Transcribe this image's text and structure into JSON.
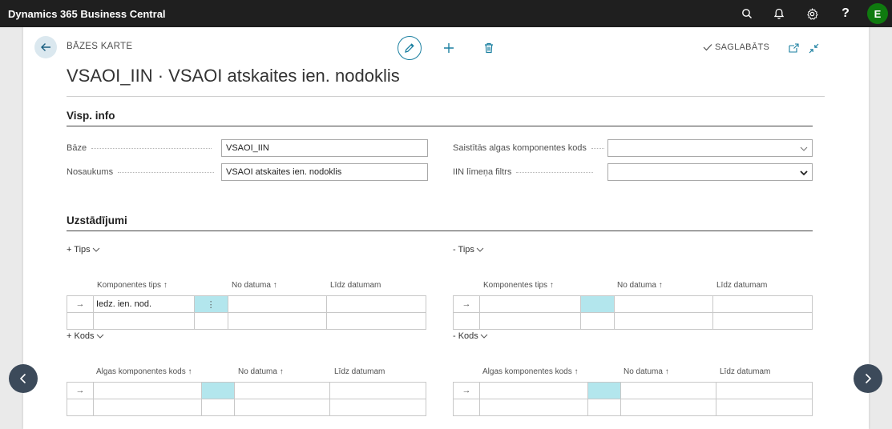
{
  "app": {
    "title": "Dynamics 365 Business Central",
    "avatar_initial": "E"
  },
  "header": {
    "breadcrumb": "BĀZES KARTE",
    "title": "VSAOI_IIN · VSAOI atskaites ien. nodoklis",
    "saved_label": "SAGLABĀTS"
  },
  "general": {
    "section_title": "Visp. info",
    "base_label": "Bāze",
    "base_value": "VSAOI_IIN",
    "name_label": "Nosaukums",
    "name_value": "VSAOI atskaites ien. nodoklis",
    "linked_label": "Saistītās algas komponentes kods",
    "linked_value": "",
    "filter_label": "IIN līmeņa filtrs",
    "filter_value": ""
  },
  "settings": {
    "section_title": "Uzstādījumi",
    "plus_tips": {
      "toggle": "+ Tips",
      "columns": [
        "Komponentes tips",
        "No datuma",
        "Līdz datumam"
      ],
      "rows": [
        [
          "Iedz. ien. nod.",
          "",
          ""
        ],
        [
          "",
          "",
          ""
        ]
      ]
    },
    "minus_tips": {
      "toggle": "- Tips",
      "columns": [
        "Komponentes tips",
        "No datuma",
        "Līdz datumam"
      ],
      "rows": [
        [
          "",
          "",
          ""
        ],
        [
          "",
          "",
          ""
        ]
      ]
    },
    "plus_kods": {
      "toggle": "+ Kods",
      "columns": [
        "Algas komponentes kods",
        "No datuma",
        "Līdz datumam"
      ],
      "rows": [
        [
          "",
          "",
          ""
        ],
        [
          "",
          "",
          ""
        ]
      ]
    },
    "minus_kods": {
      "toggle": "- Kods",
      "columns": [
        "Algas komponentes kods",
        "No datuma",
        "Līdz datumam"
      ],
      "rows": [
        [
          "",
          "",
          ""
        ],
        [
          "",
          "",
          ""
        ]
      ]
    }
  },
  "colors": {
    "accent": "#1a7fa0",
    "highlight": "#b3e6ed",
    "topbar": "#1f1f1f"
  },
  "icons": [
    "search-icon",
    "bell-icon",
    "gear-icon",
    "help-icon",
    "back-arrow-icon",
    "pencil-icon",
    "plus-icon",
    "trash-icon",
    "check-icon",
    "open-new-window-icon",
    "collapse-icon",
    "chevron-left-icon",
    "chevron-right-icon"
  ]
}
